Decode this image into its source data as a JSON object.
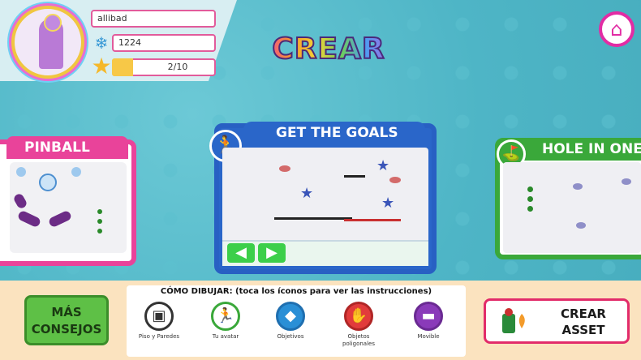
{
  "header": {
    "title": "CREAR",
    "home_icon": "home-icon"
  },
  "profile": {
    "username": "allibad",
    "score": "1224",
    "level": "2/10",
    "level_progress": 0.2
  },
  "games": [
    {
      "title": "PINBALL",
      "color": "#e9439a",
      "icon": "pinball-icon"
    },
    {
      "title": "GET THE GOALS",
      "color": "#2a66c9",
      "icon": "runner-icon"
    },
    {
      "title": "HOLE IN ONE",
      "color": "#3aa83a",
      "icon": "golf-flag-icon"
    }
  ],
  "tips_button": "MÁS CONSEJOS",
  "howto": {
    "title": "CÓMO DIBUJAR: (toca los íconos para ver las instrucciones)",
    "tools": [
      {
        "label": "Piso y Paredes",
        "icon": "floor-walls-icon",
        "color": "#333333"
      },
      {
        "label": "Tu avatar",
        "icon": "avatar-runner-icon",
        "color": "#3aa83a"
      },
      {
        "label": "Objetivos",
        "icon": "goal-diamond-icon",
        "color": "#2a8fd6"
      },
      {
        "label": "Objetos poligonales",
        "icon": "polygon-objects-icon",
        "color": "#e23b3b"
      },
      {
        "label": "Movible",
        "icon": "movable-icon",
        "color": "#8a3ab9"
      }
    ]
  },
  "asset_button": "CREAR ASSET"
}
